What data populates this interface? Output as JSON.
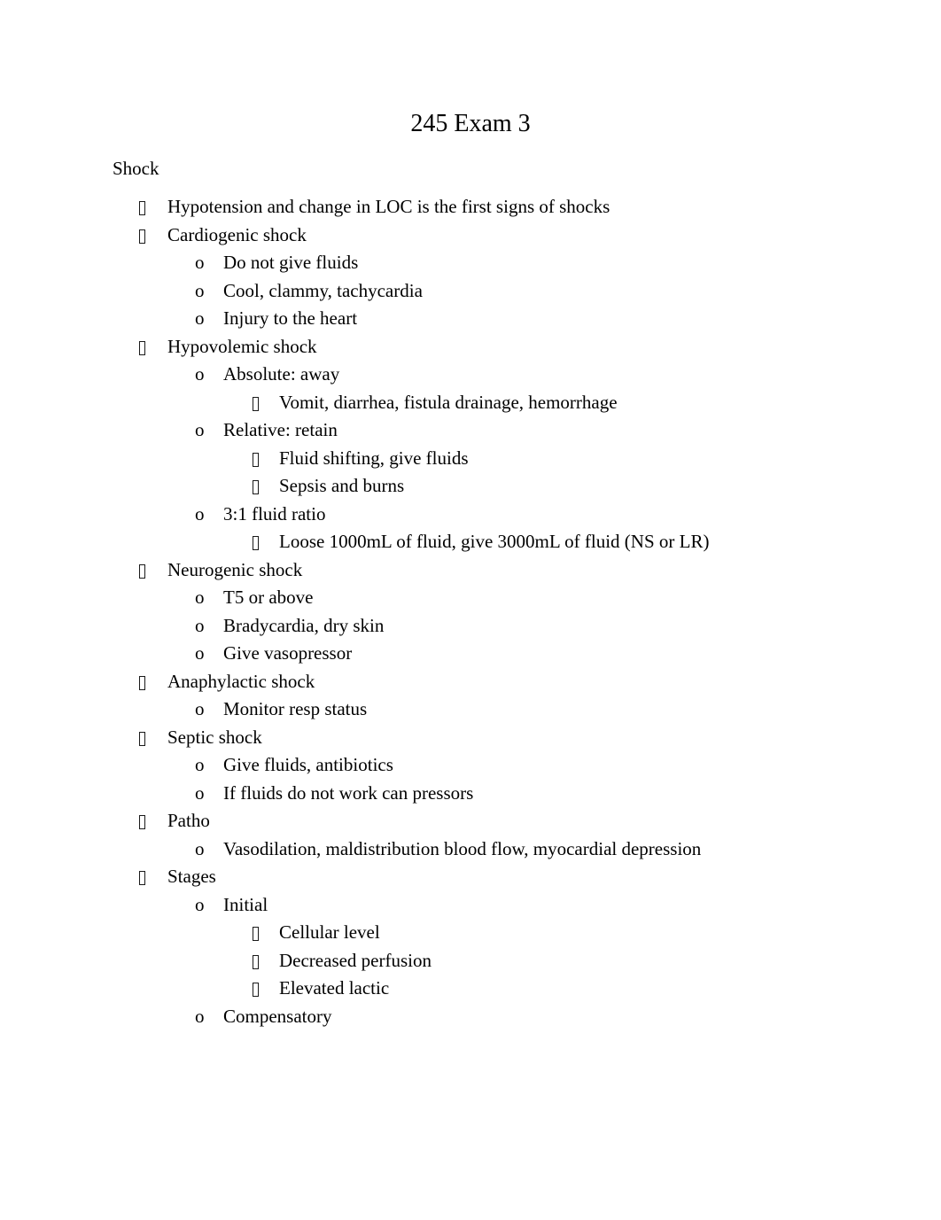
{
  "document": {
    "title": "245 Exam 3",
    "section_heading": "Shock",
    "bullet_glyphs": {
      "level1": "tofu-box",
      "level2": "o",
      "level3": "tofu-box"
    },
    "colors": {
      "text": "#000000",
      "background": "#ffffff"
    },
    "items": [
      {
        "level": 1,
        "text": "Hypotension and change in LOC is the first signs of shocks"
      },
      {
        "level": 1,
        "text": "Cardiogenic shock"
      },
      {
        "level": 2,
        "text": "Do not give fluids"
      },
      {
        "level": 2,
        "text": "Cool, clammy, tachycardia"
      },
      {
        "level": 2,
        "text": "Injury to the heart"
      },
      {
        "level": 1,
        "text": "Hypovolemic shock"
      },
      {
        "level": 2,
        "text": "Absolute: away"
      },
      {
        "level": 3,
        "text": "Vomit, diarrhea, fistula drainage, hemorrhage"
      },
      {
        "level": 2,
        "text": "Relative: retain"
      },
      {
        "level": 3,
        "text": "Fluid shifting, give fluids"
      },
      {
        "level": 3,
        "text": "Sepsis and burns"
      },
      {
        "level": 2,
        "text": "3:1 fluid ratio"
      },
      {
        "level": 3,
        "text": "Loose 1000mL of fluid, give 3000mL of fluid (NS or LR)"
      },
      {
        "level": 1,
        "text": "Neurogenic shock"
      },
      {
        "level": 2,
        "text": "T5 or above"
      },
      {
        "level": 2,
        "text": "Bradycardia, dry skin"
      },
      {
        "level": 2,
        "text": "Give vasopressor"
      },
      {
        "level": 1,
        "text": "Anaphylactic shock"
      },
      {
        "level": 2,
        "text": "Monitor resp status"
      },
      {
        "level": 1,
        "text": "Septic shock"
      },
      {
        "level": 2,
        "text": "Give fluids, antibiotics"
      },
      {
        "level": 2,
        "text": "If fluids do not work can pressors"
      },
      {
        "level": 1,
        "text": "Patho"
      },
      {
        "level": 2,
        "text": "Vasodilation, maldistribution blood flow, myocardial depression"
      },
      {
        "level": 1,
        "text": "Stages"
      },
      {
        "level": 2,
        "text": "Initial"
      },
      {
        "level": 3,
        "text": "Cellular level"
      },
      {
        "level": 3,
        "text": "Decreased perfusion"
      },
      {
        "level": 3,
        "text": "Elevated lactic"
      },
      {
        "level": 2,
        "text": "Compensatory"
      }
    ]
  }
}
